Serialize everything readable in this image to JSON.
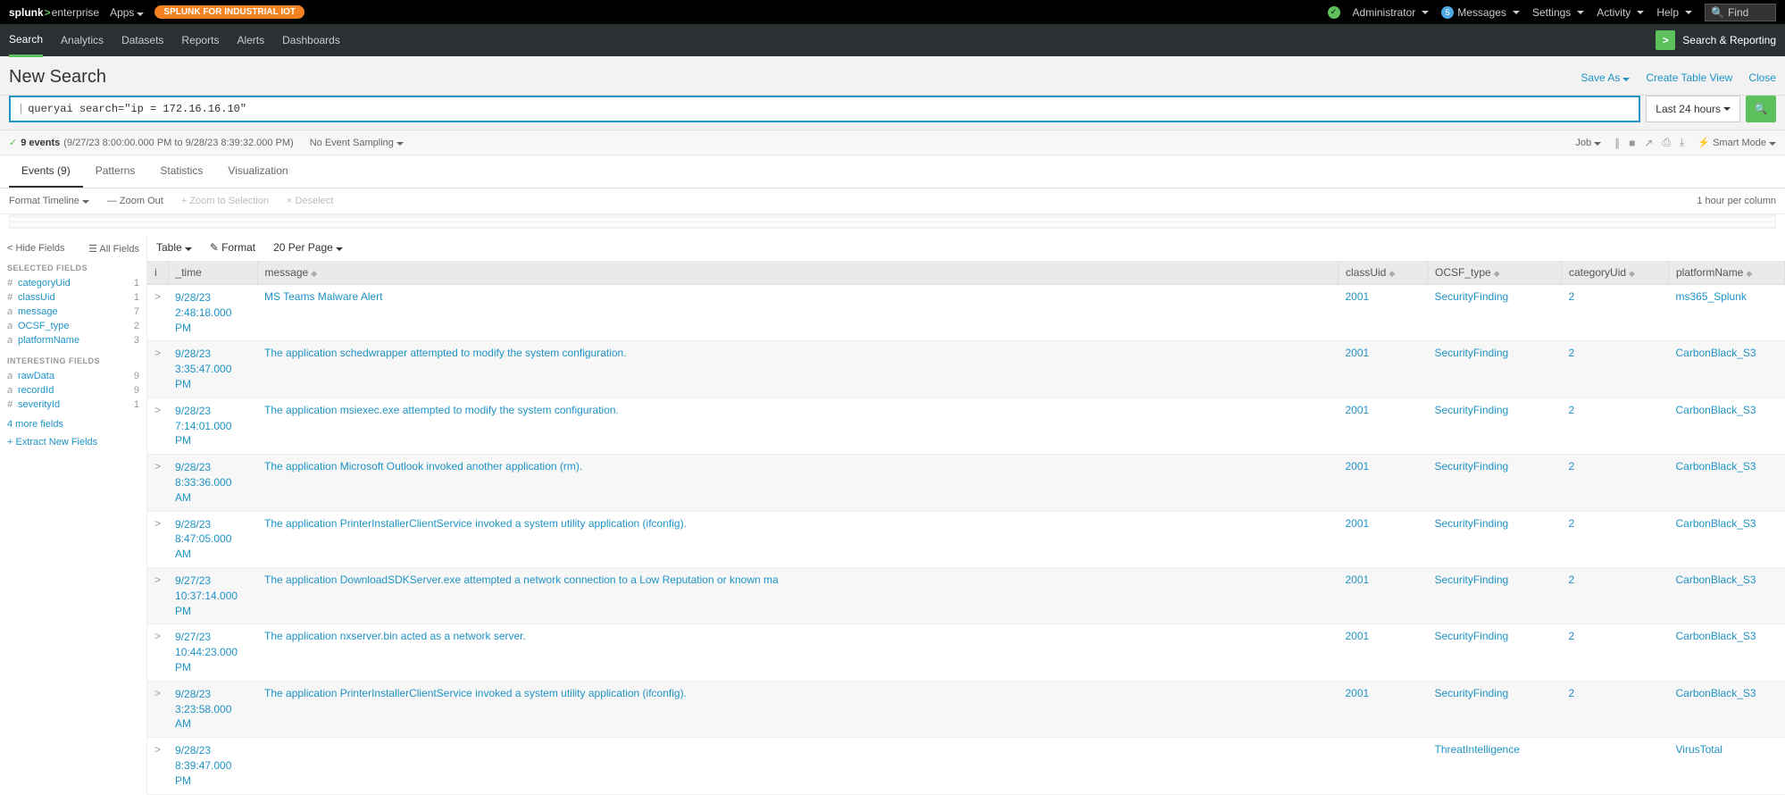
{
  "topbar": {
    "brand_splunk": "splunk",
    "brand_ent": "enterprise",
    "apps": "Apps",
    "pill": "SPLUNK FOR INDUSTRIAL IOT",
    "admin": "Administrator",
    "messages_count": "5",
    "messages": "Messages",
    "settings": "Settings",
    "activity": "Activity",
    "help": "Help",
    "find_placeholder": "Find"
  },
  "navbar": {
    "items": [
      "Search",
      "Analytics",
      "Datasets",
      "Reports",
      "Alerts",
      "Dashboards"
    ],
    "sr_label": "Search & Reporting"
  },
  "pagehead": {
    "title": "New Search",
    "save_as": "Save As",
    "create_table": "Create Table View",
    "close": "Close"
  },
  "search": {
    "query": "queryai search=\"ip = 172.16.16.10\"",
    "timerange": "Last 24 hours"
  },
  "status": {
    "count_label": "9 events",
    "range": "(9/27/23 8:00:00.000 PM to 9/28/23 8:39:32.000 PM)",
    "sampling": "No Event Sampling",
    "job": "Job",
    "smart": "Smart Mode"
  },
  "tabs": {
    "events": "Events (9)",
    "patterns": "Patterns",
    "statistics": "Statistics",
    "visualization": "Visualization"
  },
  "timeline": {
    "format": "Format Timeline",
    "zoomout": "— Zoom Out",
    "zoomsel": "+ Zoom to Selection",
    "deselect": "× Deselect",
    "per": "1 hour per column"
  },
  "sidebar": {
    "hide": "Hide Fields",
    "all": "All Fields",
    "selected_heading": "SELECTED FIELDS",
    "interesting_heading": "INTERESTING FIELDS",
    "selected": [
      {
        "type": "#",
        "name": "categoryUid",
        "count": "1"
      },
      {
        "type": "#",
        "name": "classUid",
        "count": "1"
      },
      {
        "type": "a",
        "name": "message",
        "count": "7"
      },
      {
        "type": "a",
        "name": "OCSF_type",
        "count": "2"
      },
      {
        "type": "a",
        "name": "platformName",
        "count": "3"
      }
    ],
    "interesting": [
      {
        "type": "a",
        "name": "rawData",
        "count": "9"
      },
      {
        "type": "a",
        "name": "recordId",
        "count": "9"
      },
      {
        "type": "#",
        "name": "severityId",
        "count": "1"
      }
    ],
    "more_fields": "4 more fields",
    "extract": "+ Extract New Fields"
  },
  "results_toolbar": {
    "table": "Table",
    "format": "Format",
    "perpage": "20 Per Page"
  },
  "columns": {
    "i": "i",
    "time": "_time",
    "message": "message",
    "classUid": "classUid",
    "ocsf": "OCSF_type",
    "categoryUid": "categoryUid",
    "platformName": "platformName"
  },
  "rows": [
    {
      "time": "9/28/23 2:48:18.000 PM",
      "message": "MS Teams Malware Alert",
      "classUid": "2001",
      "ocsf": "SecurityFinding",
      "categoryUid": "2",
      "platform": "ms365_Splunk"
    },
    {
      "time": "9/28/23 3:35:47.000 PM",
      "message": "The application schedwrapper attempted to modify the system configuration.",
      "classUid": "2001",
      "ocsf": "SecurityFinding",
      "categoryUid": "2",
      "platform": "CarbonBlack_S3"
    },
    {
      "time": "9/28/23 7:14:01.000 PM",
      "message": "The application msiexec.exe attempted to modify the system configuration.",
      "classUid": "2001",
      "ocsf": "SecurityFinding",
      "categoryUid": "2",
      "platform": "CarbonBlack_S3"
    },
    {
      "time": "9/28/23 8:33:36.000 AM",
      "message": "The application Microsoft Outlook invoked another application (rm).",
      "classUid": "2001",
      "ocsf": "SecurityFinding",
      "categoryUid": "2",
      "platform": "CarbonBlack_S3"
    },
    {
      "time": "9/28/23 8:47:05.000 AM",
      "message": "The application PrinterInstallerClientService invoked a system utility application (ifconfig).",
      "classUid": "2001",
      "ocsf": "SecurityFinding",
      "categoryUid": "2",
      "platform": "CarbonBlack_S3"
    },
    {
      "time": "9/27/23 10:37:14.000 PM",
      "message": "The application DownloadSDKServer.exe attempted a network connection to a Low Reputation or known ma",
      "classUid": "2001",
      "ocsf": "SecurityFinding",
      "categoryUid": "2",
      "platform": "CarbonBlack_S3"
    },
    {
      "time": "9/27/23 10:44:23.000 PM",
      "message": "The application nxserver.bin acted as a network server.",
      "classUid": "2001",
      "ocsf": "SecurityFinding",
      "categoryUid": "2",
      "platform": "CarbonBlack_S3"
    },
    {
      "time": "9/28/23 3:23:58.000 AM",
      "message": "The application PrinterInstallerClientService invoked a system utility application (ifconfig).",
      "classUid": "2001",
      "ocsf": "SecurityFinding",
      "categoryUid": "2",
      "platform": "CarbonBlack_S3"
    },
    {
      "time": "9/28/23 8:39:47.000 PM",
      "message": "",
      "classUid": "",
      "ocsf": "ThreatIntelligence",
      "categoryUid": "",
      "platform": "VirusTotal"
    }
  ]
}
